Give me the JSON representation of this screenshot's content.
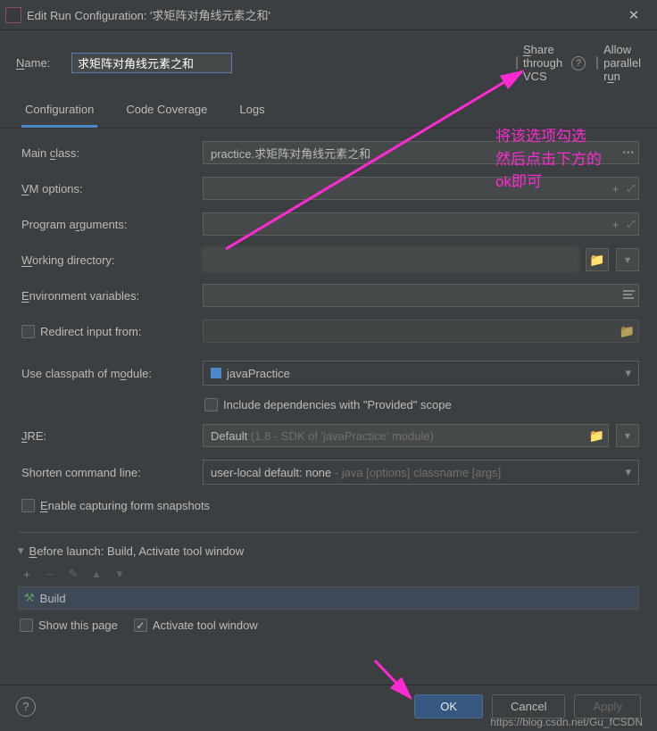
{
  "title": "Edit Run Configuration: '求矩阵对角线元素之和'",
  "name_label": "Name:",
  "name_value": "求矩阵对角线元素之和",
  "share_label": "Share through VCS",
  "parallel_label": "Allow parallel run",
  "tabs": {
    "config": "Configuration",
    "coverage": "Code Coverage",
    "logs": "Logs"
  },
  "labels": {
    "main_class": "Main class:",
    "vm_options": "VM options:",
    "program_args": "Program arguments:",
    "working_dir": "Working directory:",
    "env_vars": "Environment variables:",
    "redirect": "Redirect input from:",
    "classpath": "Use classpath of module:",
    "include_deps": "Include dependencies with \"Provided\" scope",
    "jre": "JRE:",
    "shorten": "Shorten command line:",
    "snapshots": "Enable capturing form snapshots"
  },
  "values": {
    "main_class": "practice.求矩阵对角线元素之和",
    "module": "javaPractice",
    "jre": "Default",
    "jre_hint": "(1.8 - SDK of 'javaPractice' module)",
    "shorten": "user-local default: none",
    "shorten_hint": "- java [options] classname [args]"
  },
  "before_launch": {
    "title": "Before launch: Build, Activate tool window",
    "build": "Build",
    "show": "Show this page",
    "activate": "Activate tool window"
  },
  "buttons": {
    "ok": "OK",
    "cancel": "Cancel",
    "apply": "Apply"
  },
  "annotation": "将该选项勾选\n然后点击下方的\nok即可",
  "watermark": "https://blog.csdn.net/Gu_fCSDN"
}
